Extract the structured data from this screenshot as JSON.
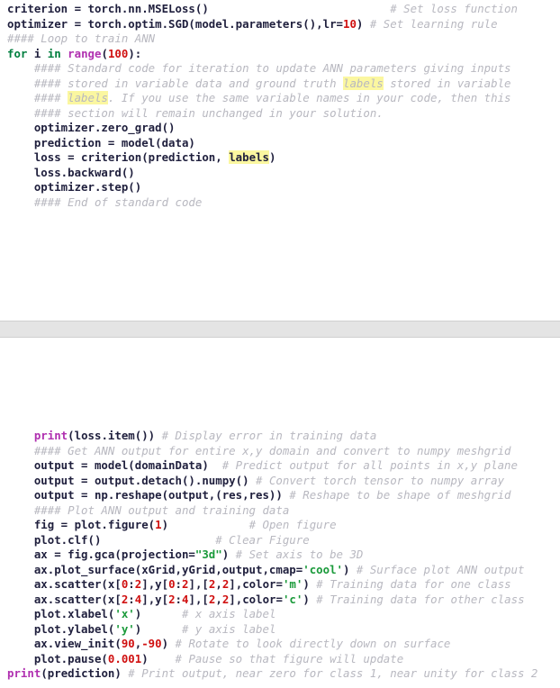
{
  "colors": {
    "background": "#ffffff",
    "code_text": "#1f1f3d",
    "keyword": "#007f3f",
    "function": "#b030b0",
    "number": "#d01010",
    "string": "#1a9a3a",
    "comment": "#b8b8c0",
    "highlight": "#fbf7a0",
    "separator_band": "#e4e4e4",
    "separator_border": "#cfcfcf"
  },
  "top_block": {
    "lines": [
      [
        {
          "t": "criterion = torch.nn.MSELoss()",
          "c": "plain"
        },
        {
          "t": "                           ",
          "c": "plain"
        },
        {
          "t": "# Set loss function",
          "c": "comment"
        }
      ],
      [
        {
          "t": "optimizer = torch.optim.SGD(model.parameters(),lr=",
          "c": "plain"
        },
        {
          "t": "10",
          "c": "num"
        },
        {
          "t": ")",
          "c": "plain"
        },
        {
          "t": " # Set learning rule",
          "c": "comment"
        }
      ],
      [
        {
          "t": "#### Loop to train ANN",
          "c": "comment"
        }
      ],
      [
        {
          "t": "for",
          "c": "kw"
        },
        {
          "t": " i ",
          "c": "plain"
        },
        {
          "t": "in",
          "c": "kw"
        },
        {
          "t": " ",
          "c": "plain"
        },
        {
          "t": "range",
          "c": "fn"
        },
        {
          "t": "(",
          "c": "plain"
        },
        {
          "t": "100",
          "c": "num"
        },
        {
          "t": "):",
          "c": "plain"
        }
      ],
      [
        {
          "t": "    #### Standard code for iteration to update ANN parameters giving inputs",
          "c": "comment"
        }
      ],
      [
        {
          "t": "    #### stored in variable data and ground truth ",
          "c": "comment"
        },
        {
          "t": "labels",
          "c": "comment-hl"
        },
        {
          "t": " stored in variable",
          "c": "comment"
        }
      ],
      [
        {
          "t": "    #### ",
          "c": "comment"
        },
        {
          "t": "labels",
          "c": "comment-hl"
        },
        {
          "t": ". If you use the same variable names in your code, then this",
          "c": "comment"
        }
      ],
      [
        {
          "t": "    #### section will remain unchanged in your solution.",
          "c": "comment"
        }
      ],
      [
        {
          "t": "    optimizer.zero_grad()",
          "c": "plain"
        }
      ],
      [
        {
          "t": "    prediction = model(data)",
          "c": "plain"
        }
      ],
      [
        {
          "t": "    loss = criterion(prediction, ",
          "c": "plain"
        },
        {
          "t": "labels",
          "c": "hl"
        },
        {
          "t": ")",
          "c": "plain"
        }
      ],
      [
        {
          "t": "    loss.backward()",
          "c": "plain"
        }
      ],
      [
        {
          "t": "    optimizer.step()",
          "c": "plain"
        }
      ],
      [
        {
          "t": "    #### End of standard code",
          "c": "comment"
        }
      ]
    ]
  },
  "bottom_block": {
    "lines": [
      [
        {
          "t": "    ",
          "c": "plain"
        },
        {
          "t": "print",
          "c": "fn"
        },
        {
          "t": "(loss.item())",
          "c": "plain"
        },
        {
          "t": " # Display error in training data",
          "c": "comment"
        }
      ],
      [
        {
          "t": "    #### Get ANN output for entire x,y domain and convert to numpy meshgrid",
          "c": "comment"
        }
      ],
      [
        {
          "t": "    output = model(domainData)",
          "c": "plain"
        },
        {
          "t": "  # Predict output for all points in x,y plane",
          "c": "comment"
        }
      ],
      [
        {
          "t": "    output = output.detach().numpy()",
          "c": "plain"
        },
        {
          "t": " # Convert torch tensor to numpy array",
          "c": "comment"
        }
      ],
      [
        {
          "t": "    output = np.reshape(output,(res,res))",
          "c": "plain"
        },
        {
          "t": " # Reshape to be shape of meshgrid",
          "c": "comment"
        }
      ],
      [
        {
          "t": "    #### Plot ANN output and training data",
          "c": "comment"
        }
      ],
      [
        {
          "t": "    fig = plot.figure(",
          "c": "plain"
        },
        {
          "t": "1",
          "c": "num"
        },
        {
          "t": ")",
          "c": "plain"
        },
        {
          "t": "            # Open figure",
          "c": "comment"
        }
      ],
      [
        {
          "t": "    plot.clf()",
          "c": "plain"
        },
        {
          "t": "                 # Clear Figure",
          "c": "comment"
        }
      ],
      [
        {
          "t": "    ax = fig.gca(projection=",
          "c": "plain"
        },
        {
          "t": "\"3d\"",
          "c": "str"
        },
        {
          "t": ")",
          "c": "plain"
        },
        {
          "t": " # Set axis to be 3D",
          "c": "comment"
        }
      ],
      [
        {
          "t": "    ax.plot_surface(xGrid,yGrid,output,cmap=",
          "c": "plain"
        },
        {
          "t": "'cool'",
          "c": "str"
        },
        {
          "t": ")",
          "c": "plain"
        },
        {
          "t": " # Surface plot ANN output",
          "c": "comment"
        }
      ],
      [
        {
          "t": "    ax.scatter(x[",
          "c": "plain"
        },
        {
          "t": "0",
          "c": "num"
        },
        {
          "t": ":",
          "c": "plain"
        },
        {
          "t": "2",
          "c": "num"
        },
        {
          "t": "],y[",
          "c": "plain"
        },
        {
          "t": "0",
          "c": "num"
        },
        {
          "t": ":",
          "c": "plain"
        },
        {
          "t": "2",
          "c": "num"
        },
        {
          "t": "],[",
          "c": "plain"
        },
        {
          "t": "2",
          "c": "num"
        },
        {
          "t": ",",
          "c": "plain"
        },
        {
          "t": "2",
          "c": "num"
        },
        {
          "t": "],color=",
          "c": "plain"
        },
        {
          "t": "'m'",
          "c": "str"
        },
        {
          "t": ")",
          "c": "plain"
        },
        {
          "t": " # Training data for one class",
          "c": "comment"
        }
      ],
      [
        {
          "t": "    ax.scatter(x[",
          "c": "plain"
        },
        {
          "t": "2",
          "c": "num"
        },
        {
          "t": ":",
          "c": "plain"
        },
        {
          "t": "4",
          "c": "num"
        },
        {
          "t": "],y[",
          "c": "plain"
        },
        {
          "t": "2",
          "c": "num"
        },
        {
          "t": ":",
          "c": "plain"
        },
        {
          "t": "4",
          "c": "num"
        },
        {
          "t": "],[",
          "c": "plain"
        },
        {
          "t": "2",
          "c": "num"
        },
        {
          "t": ",",
          "c": "plain"
        },
        {
          "t": "2",
          "c": "num"
        },
        {
          "t": "],color=",
          "c": "plain"
        },
        {
          "t": "'c'",
          "c": "str"
        },
        {
          "t": ")",
          "c": "plain"
        },
        {
          "t": " # Training data for other class",
          "c": "comment"
        }
      ],
      [
        {
          "t": "    plot.xlabel(",
          "c": "plain"
        },
        {
          "t": "'x'",
          "c": "str"
        },
        {
          "t": ")",
          "c": "plain"
        },
        {
          "t": "      # x axis label",
          "c": "comment"
        }
      ],
      [
        {
          "t": "    plot.ylabel(",
          "c": "plain"
        },
        {
          "t": "'y'",
          "c": "str"
        },
        {
          "t": ")",
          "c": "plain"
        },
        {
          "t": "      # y axis label",
          "c": "comment"
        }
      ],
      [
        {
          "t": "    ax.view_init(",
          "c": "plain"
        },
        {
          "t": "90",
          "c": "num"
        },
        {
          "t": ",",
          "c": "plain"
        },
        {
          "t": "-90",
          "c": "num"
        },
        {
          "t": ")",
          "c": "plain"
        },
        {
          "t": " # Rotate to look directly down on surface",
          "c": "comment"
        }
      ],
      [
        {
          "t": "    plot.pause(",
          "c": "plain"
        },
        {
          "t": "0.001",
          "c": "num"
        },
        {
          "t": ")",
          "c": "plain"
        },
        {
          "t": "    # Pause so that figure will update",
          "c": "comment"
        }
      ],
      [
        {
          "t": "print",
          "c": "fn"
        },
        {
          "t": "(prediction)",
          "c": "plain"
        },
        {
          "t": " # Print output, near zero for class 1, near unity for class 2",
          "c": "comment"
        }
      ]
    ]
  }
}
